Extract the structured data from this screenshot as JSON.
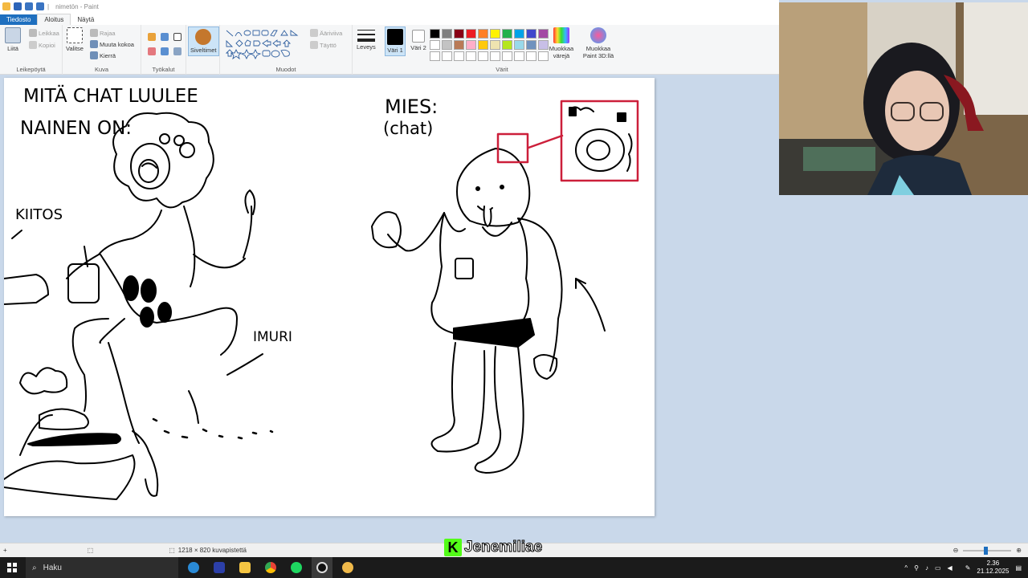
{
  "window": {
    "title": "nimetön - Paint"
  },
  "tabs": [
    {
      "label": "Tiedosto"
    },
    {
      "label": "Aloitus"
    },
    {
      "label": "Näytä"
    }
  ],
  "ribbon": {
    "clipboard": {
      "paste": "Liitä",
      "cut": "Leikkaa",
      "copy": "Kopioi",
      "label": "Leikepöytä"
    },
    "image": {
      "select": "Valitse",
      "crop": "Rajaa",
      "resize": "Muuta kokoa",
      "rotate": "Kierrä",
      "label": "Kuva"
    },
    "tools": {
      "label": "Työkalut"
    },
    "brushes": {
      "label": "Siveltimet"
    },
    "shapes": {
      "outline": "Ääriviiva",
      "fill": "Täyttö",
      "label": "Muodot"
    },
    "size": {
      "label": "Leveys"
    },
    "colors": {
      "color1": "Väri 1",
      "color2": "Väri 2",
      "edit": "Muokkaa värejä",
      "paint3d": "Muokkaa Paint 3D:llä",
      "label": "Värit",
      "palette": [
        "#000000",
        "#7f7f7f",
        "#880015",
        "#ed1c24",
        "#ff7f27",
        "#fff200",
        "#22b14c",
        "#00a2e8",
        "#3f48cc",
        "#a349a4",
        "#ffffff",
        "#c3c3c3",
        "#b97a57",
        "#ffaec9",
        "#ffc90e",
        "#efe4b0",
        "#b5e61d",
        "#99d9ea",
        "#7092be",
        "#c8bfe7",
        "#ffffff",
        "#ffffff",
        "#ffffff",
        "#ffffff",
        "#ffffff",
        "#ffffff",
        "#ffffff",
        "#ffffff",
        "#ffffff",
        "#ffffff"
      ]
    }
  },
  "drawing": {
    "title_left_1": "MITÄ CHAT LUULEE",
    "title_left_2": "NAINEN ON:",
    "label_kiitos": "KIITOS",
    "label_imuri": "IMURI",
    "title_right_1": "MIES:",
    "title_right_2": "(chat)"
  },
  "status": {
    "size": "1218 × 820 kuvapistettä"
  },
  "overlay": {
    "channel": "Jenemiliae",
    "logo": "K"
  },
  "taskbar": {
    "search": "Haku",
    "time": "2.36",
    "date": "21.12.2025"
  }
}
